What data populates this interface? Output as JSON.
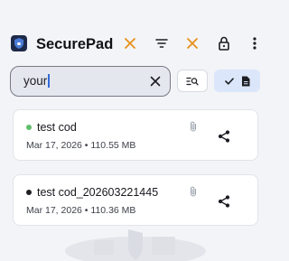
{
  "app": {
    "title": "SecurePad"
  },
  "colors": {
    "accent": "#2f6ad9",
    "close_orange": "#e8901a",
    "dot_green": "#5fbf6b",
    "dot_dark": "#1f2023"
  },
  "header": {
    "icons": [
      "close-icon",
      "sort-icon",
      "close-icon",
      "lock-icon",
      "more-vert-icon"
    ]
  },
  "search": {
    "value": "your",
    "clear_icon": "close-icon"
  },
  "filters": {
    "scope_icon": "search-list-icon",
    "active_icons": [
      "check-icon",
      "document-icon"
    ]
  },
  "notes": [
    {
      "title": "test cod",
      "date": "Mar 17, 2026",
      "size": "110.55 MB",
      "status_color": "#5fbf6b",
      "has_attachment": true
    },
    {
      "title": "test cod_202603221445",
      "date": "Mar 17, 2026",
      "size": "110.36 MB",
      "status_color": "#1f2023",
      "has_attachment": true
    }
  ],
  "separator": "•"
}
